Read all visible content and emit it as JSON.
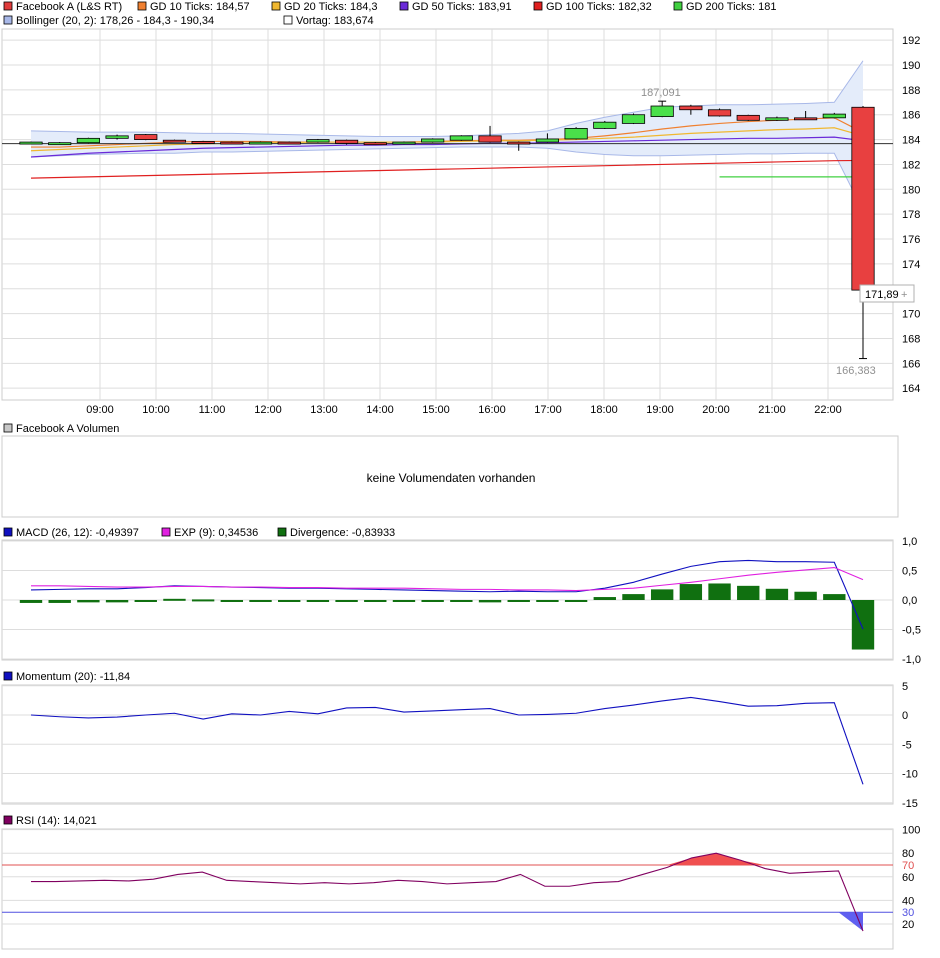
{
  "legends": {
    "price": [
      {
        "text": "Facebook A (L&S RT)",
        "color": "#e03c3c"
      },
      {
        "text": "GD 10 Ticks: 184,57",
        "color": "#f08030"
      },
      {
        "text": "GD 20 Ticks: 184,3",
        "color": "#f0b830"
      },
      {
        "text": "GD 50 Ticks: 183,91",
        "color": "#6a2ad8"
      },
      {
        "text": "GD 100 Ticks: 182,32",
        "color": "#e02020"
      },
      {
        "text": "GD 200 Ticks: 181",
        "color": "#40d040"
      }
    ],
    "price2": [
      {
        "text": "Bollinger (20, 2): 178,26 - 184,3 - 190,34",
        "color": "#a8b8e8"
      },
      {
        "text": "Vortag: 183,674",
        "color": "#ffffff"
      }
    ],
    "volume": {
      "text": "Facebook A Volumen",
      "color": "#c8c8c8"
    },
    "macd": [
      {
        "text": "MACD (26, 12): -0,49397",
        "color": "#1010c0"
      },
      {
        "text": "EXP (9): 0,34536",
        "color": "#e020e0"
      },
      {
        "text": "Divergence: -0,83933",
        "color": "#107010"
      }
    ],
    "momentum": {
      "text": "Momentum (20): -11,84",
      "color": "#1010c0"
    },
    "rsi": {
      "text": "RSI (14): 14,021",
      "color": "#800060"
    }
  },
  "volume_message": "keine Volumendaten vorhanden",
  "price_annotations": {
    "high": "187,091",
    "low": "166,383",
    "last": "171,89",
    "last_suffix": "+"
  },
  "colors": {
    "up": "#4ae04a",
    "down": "#e84040",
    "bollinger_fill": "#e4ecfa",
    "bollinger_line": "#a8b8e8",
    "grid": "#dddddd",
    "vortag": "#202020"
  },
  "chart_data": [
    {
      "type": "candlestick",
      "x_tick_labels": [
        "09:00",
        "10:00",
        "11:00",
        "12:00",
        "13:00",
        "14:00",
        "15:00",
        "16:00",
        "17:00",
        "18:00",
        "19:00",
        "20:00",
        "21:00",
        "22:00"
      ],
      "y_tick_labels": [
        "192",
        "190",
        "188",
        "186",
        "184",
        "182",
        "180",
        "178",
        "176",
        "174",
        "2",
        "170",
        "168",
        "166",
        "164"
      ],
      "ylim": [
        163,
        193
      ],
      "vortag": 183.674,
      "candles": [
        {
          "open": 183.8,
          "close": 183.8,
          "high": 183.85,
          "low": 183.75
        },
        {
          "open": 183.75,
          "close": 183.75,
          "high": 183.8,
          "low": 183.7
        },
        {
          "open": 183.75,
          "close": 184.1,
          "high": 184.15,
          "low": 183.7
        },
        {
          "open": 184.1,
          "close": 184.3,
          "high": 184.4,
          "low": 184.0
        },
        {
          "open": 184.4,
          "close": 184.0,
          "high": 184.45,
          "low": 183.95
        },
        {
          "open": 183.95,
          "close": 183.9,
          "high": 184.0,
          "low": 183.85
        },
        {
          "open": 183.85,
          "close": 183.75,
          "high": 183.9,
          "low": 183.7
        },
        {
          "open": 183.8,
          "close": 183.75,
          "high": 183.85,
          "low": 183.7
        },
        {
          "open": 183.75,
          "close": 183.8,
          "high": 183.85,
          "low": 183.7
        },
        {
          "open": 183.8,
          "close": 183.75,
          "high": 183.85,
          "low": 183.65
        },
        {
          "open": 183.8,
          "close": 184.0,
          "high": 184.05,
          "low": 183.75
        },
        {
          "open": 183.95,
          "close": 183.7,
          "high": 184.0,
          "low": 183.6
        },
        {
          "open": 183.75,
          "close": 183.7,
          "high": 183.8,
          "low": 183.6
        },
        {
          "open": 183.7,
          "close": 183.8,
          "high": 183.85,
          "low": 183.6
        },
        {
          "open": 183.8,
          "close": 184.05,
          "high": 184.1,
          "low": 183.75
        },
        {
          "open": 183.95,
          "close": 184.3,
          "high": 184.35,
          "low": 183.9
        },
        {
          "open": 184.3,
          "close": 183.8,
          "high": 185.1,
          "low": 183.75
        },
        {
          "open": 183.8,
          "close": 183.75,
          "high": 183.85,
          "low": 183.1
        },
        {
          "open": 183.8,
          "close": 184.05,
          "high": 184.5,
          "low": 183.75
        },
        {
          "open": 184.05,
          "close": 184.9,
          "high": 185.0,
          "low": 184.0
        },
        {
          "open": 184.9,
          "close": 185.4,
          "high": 185.5,
          "low": 184.85
        },
        {
          "open": 185.3,
          "close": 186.0,
          "high": 186.1,
          "low": 185.25
        },
        {
          "open": 185.85,
          "close": 186.7,
          "high": 187.09,
          "low": 185.8
        },
        {
          "open": 186.7,
          "close": 186.4,
          "high": 186.8,
          "low": 186.0
        },
        {
          "open": 186.4,
          "close": 185.9,
          "high": 186.5,
          "low": 185.85
        },
        {
          "open": 185.95,
          "close": 185.55,
          "high": 186.0,
          "low": 185.5
        },
        {
          "open": 185.55,
          "close": 185.75,
          "high": 185.85,
          "low": 185.5
        },
        {
          "open": 185.75,
          "close": 185.7,
          "high": 186.3,
          "low": 185.6
        },
        {
          "open": 185.75,
          "close": 186.05,
          "high": 186.15,
          "low": 185.7
        },
        {
          "open": 186.6,
          "close": 171.89,
          "high": 186.7,
          "low": 166.383
        }
      ],
      "series": [
        {
          "name": "GD 10 Ticks",
          "color": "#f08030",
          "values": [
            183.4,
            183.4,
            183.5,
            183.6,
            183.7,
            183.8,
            183.85,
            183.85,
            183.85,
            183.8,
            183.8,
            183.8,
            183.8,
            183.8,
            183.85,
            183.9,
            183.95,
            183.95,
            184.0,
            184.1,
            184.3,
            184.55,
            184.85,
            185.1,
            185.3,
            185.45,
            185.55,
            185.65,
            185.75,
            184.57
          ]
        },
        {
          "name": "GD 20 Ticks",
          "color": "#f0b830",
          "values": [
            183.1,
            183.2,
            183.3,
            183.4,
            183.5,
            183.6,
            183.65,
            183.7,
            183.75,
            183.75,
            183.8,
            183.8,
            183.8,
            183.8,
            183.8,
            183.85,
            183.9,
            183.9,
            183.95,
            184.0,
            184.1,
            184.2,
            184.35,
            184.5,
            184.6,
            184.7,
            184.8,
            184.85,
            184.95,
            184.3
          ]
        },
        {
          "name": "GD 50 Ticks",
          "color": "#6a2ad8",
          "values": [
            182.6,
            182.75,
            182.9,
            183.0,
            183.1,
            183.2,
            183.3,
            183.35,
            183.4,
            183.45,
            183.5,
            183.55,
            183.55,
            183.6,
            183.6,
            183.65,
            183.7,
            183.7,
            183.75,
            183.8,
            183.85,
            183.9,
            183.95,
            184.0,
            184.05,
            184.1,
            184.1,
            184.15,
            184.2,
            183.91
          ]
        },
        {
          "name": "GD 100 Ticks",
          "color": "#e02020",
          "values": [
            180.9,
            180.95,
            181.0,
            181.05,
            181.1,
            181.15,
            181.2,
            181.25,
            181.3,
            181.35,
            181.4,
            181.45,
            181.5,
            181.55,
            181.6,
            181.65,
            181.7,
            181.75,
            181.8,
            181.85,
            181.9,
            181.95,
            182.0,
            182.05,
            182.1,
            182.15,
            182.2,
            182.25,
            182.3,
            182.32
          ]
        },
        {
          "name": "GD 200 Ticks",
          "color": "#40d040",
          "values": [
            null,
            null,
            null,
            null,
            null,
            null,
            null,
            null,
            null,
            null,
            null,
            null,
            null,
            null,
            null,
            null,
            null,
            null,
            null,
            null,
            null,
            null,
            null,
            null,
            181.0,
            181.0,
            181.0,
            181.0,
            181.0,
            181.0
          ]
        }
      ],
      "bollinger": {
        "upper": [
          184.7,
          184.65,
          184.6,
          184.6,
          184.6,
          184.55,
          184.5,
          184.5,
          184.45,
          184.4,
          184.35,
          184.3,
          184.25,
          184.25,
          184.25,
          184.3,
          184.4,
          184.5,
          184.7,
          185.3,
          185.8,
          186.2,
          186.6,
          186.7,
          186.8,
          186.8,
          186.85,
          186.9,
          187.0,
          190.34
        ],
        "lower": [
          182.6,
          182.7,
          182.8,
          182.85,
          182.9,
          182.9,
          183.0,
          183.0,
          183.05,
          183.1,
          183.15,
          183.2,
          183.25,
          183.3,
          183.35,
          183.4,
          183.4,
          183.4,
          183.3,
          183.0,
          182.8,
          182.7,
          182.7,
          182.75,
          182.8,
          182.85,
          182.85,
          182.9,
          182.9,
          178.26
        ]
      }
    },
    {
      "type": "bar+line",
      "title": "MACD",
      "y_tick_labels": [
        "1,0",
        "0,5",
        "0,0",
        "-0,5",
        "-1,0"
      ],
      "ylim": [
        -1.0,
        1.0
      ],
      "series": [
        {
          "name": "MACD (26, 12)",
          "color": "#1010c0",
          "values": [
            0.17,
            0.18,
            0.19,
            0.19,
            0.21,
            0.24,
            0.23,
            0.22,
            0.21,
            0.2,
            0.2,
            0.19,
            0.18,
            0.17,
            0.16,
            0.15,
            0.14,
            0.15,
            0.14,
            0.14,
            0.2,
            0.3,
            0.44,
            0.57,
            0.65,
            0.67,
            0.65,
            0.65,
            0.64,
            -0.49397
          ]
        },
        {
          "name": "EXP (9)",
          "color": "#e020e0",
          "values": [
            0.24,
            0.24,
            0.23,
            0.22,
            0.22,
            0.23,
            0.23,
            0.22,
            0.22,
            0.21,
            0.21,
            0.2,
            0.2,
            0.2,
            0.19,
            0.18,
            0.18,
            0.17,
            0.17,
            0.16,
            0.18,
            0.2,
            0.25,
            0.3,
            0.36,
            0.42,
            0.47,
            0.51,
            0.55,
            0.34536
          ]
        }
      ],
      "divergence": [
        -0.05,
        -0.05,
        -0.04,
        -0.04,
        -0.02,
        0.02,
        0.01,
        0.0,
        0.0,
        -0.01,
        -0.02,
        -0.02,
        -0.02,
        -0.03,
        -0.03,
        -0.03,
        -0.04,
        -0.02,
        -0.03,
        -0.03,
        0.05,
        0.1,
        0.18,
        0.27,
        0.28,
        0.24,
        0.19,
        0.14,
        0.1,
        -0.83933
      ]
    },
    {
      "type": "line",
      "title": "Momentum",
      "y_tick_labels": [
        "5",
        "0",
        "-5",
        "-10",
        "-15"
      ],
      "ylim": [
        -15,
        5
      ],
      "series": [
        {
          "name": "Momentum (20)",
          "color": "#1010c0",
          "values": [
            0.0,
            -0.3,
            -0.5,
            -0.35,
            0.0,
            0.3,
            -0.7,
            0.2,
            0.0,
            0.6,
            0.2,
            1.2,
            1.3,
            0.5,
            0.7,
            0.9,
            1.1,
            0.0,
            0.1,
            0.3,
            1.1,
            1.7,
            2.4,
            3.0,
            2.3,
            1.5,
            1.6,
            2.0,
            2.1,
            -11.84
          ]
        }
      ]
    },
    {
      "type": "line",
      "title": "RSI",
      "y_tick_labels": [
        "100",
        "80",
        "70",
        "60",
        "40",
        "30",
        "20"
      ],
      "ylim": [
        0,
        100
      ],
      "thresholds": {
        "upper": 70,
        "lower": 30
      },
      "series": [
        {
          "name": "RSI (14)",
          "color": "#800060",
          "values": [
            56,
            56,
            56.5,
            57,
            56.5,
            58,
            62,
            64,
            57,
            56,
            55,
            54,
            55,
            54,
            55,
            57,
            56,
            54,
            55,
            56,
            62,
            52,
            52,
            55,
            56,
            62,
            68,
            76,
            80,
            74,
            67,
            63,
            64,
            65,
            14.021
          ]
        }
      ]
    }
  ]
}
